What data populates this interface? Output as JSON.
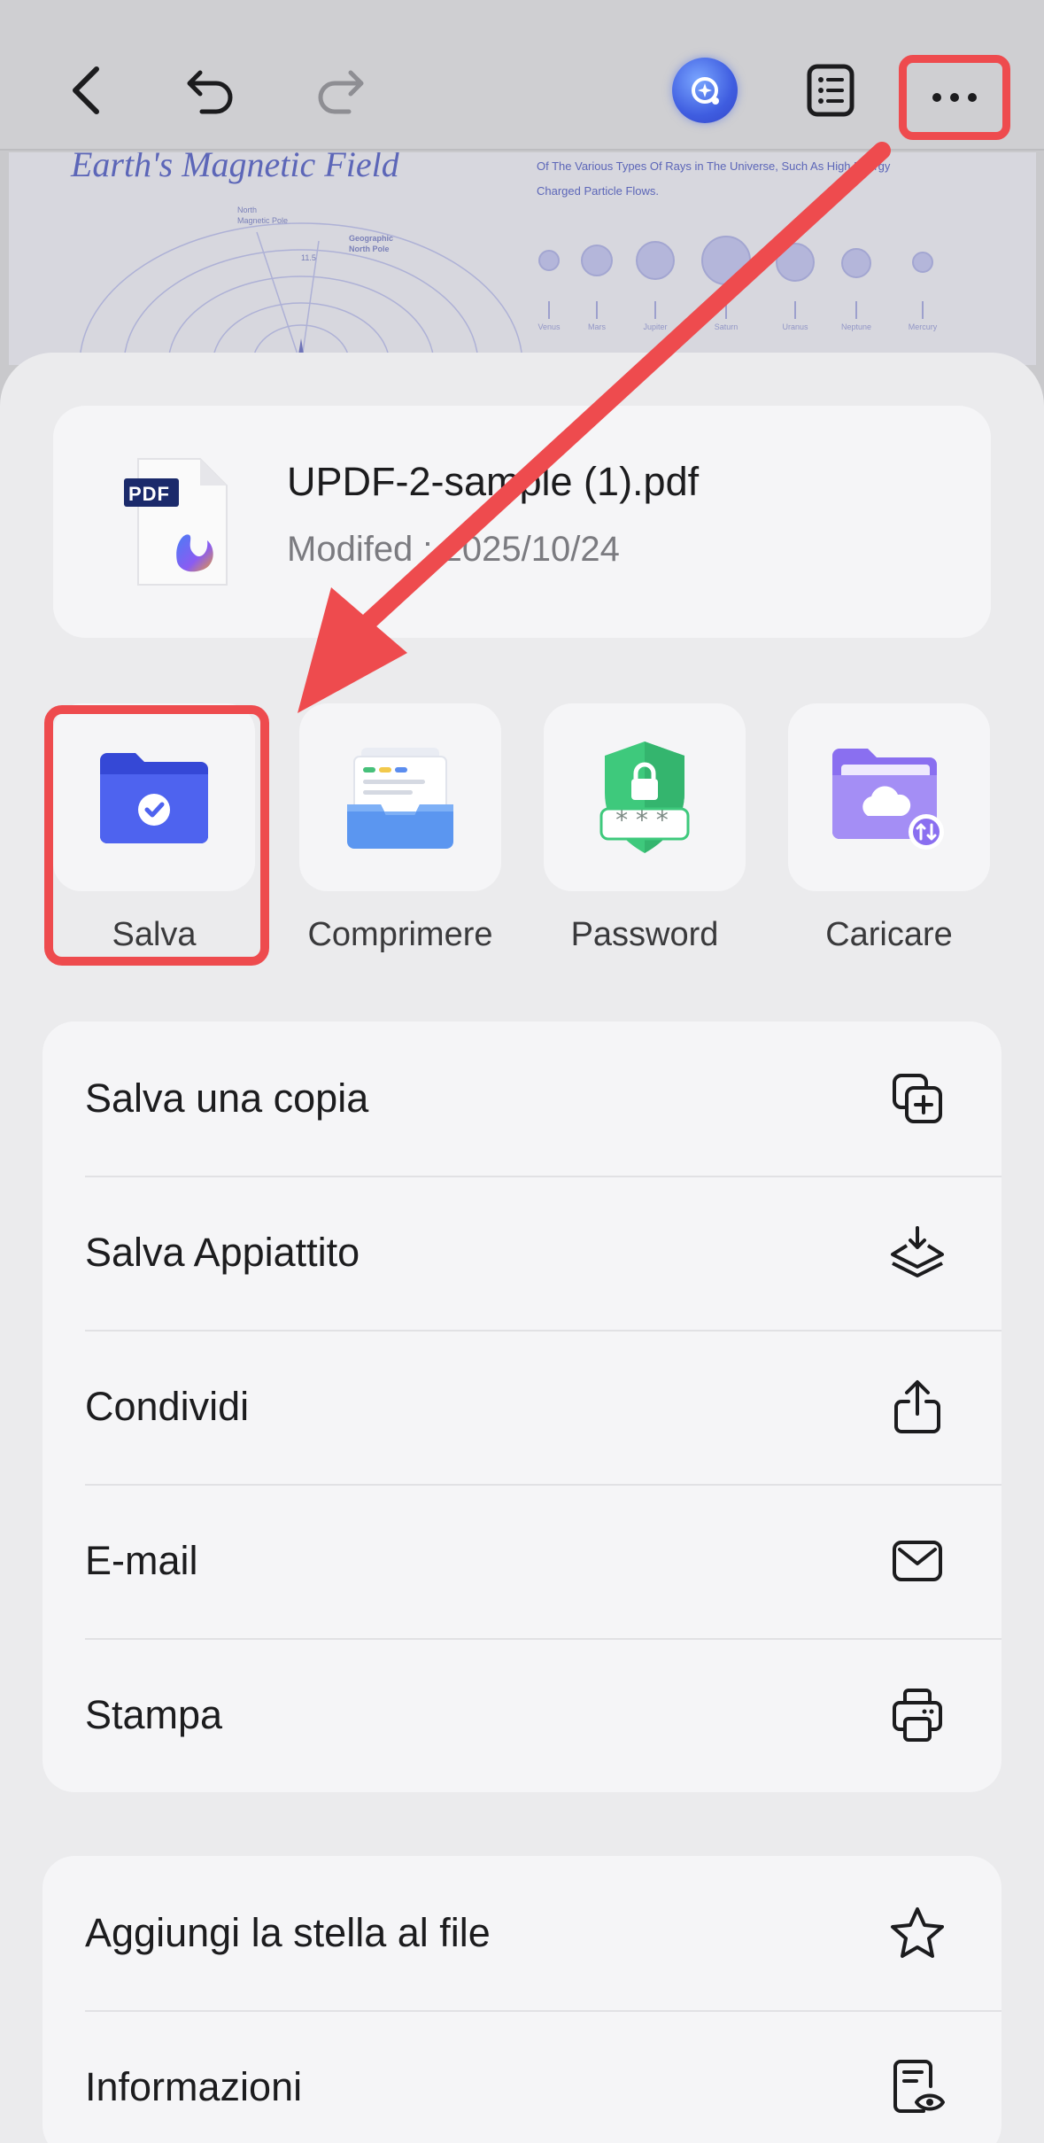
{
  "toolbar": {
    "back_icon": "chevron-left-icon",
    "undo_icon": "undo-icon",
    "redo_icon": "redo-icon",
    "ai_icon": "ai-assistant-icon",
    "outline_icon": "list-icon",
    "more_icon": "more-icon"
  },
  "background_pdf": {
    "title": "Earth's Magnetic Field",
    "text_line_1": "Of The Various Types Of Rays in The Universe, Such As High Energy",
    "text_line_2": "Charged Particle Flows.",
    "label_north_magnetic": "North",
    "label_north_magnetic_2": "Magnetic Pole",
    "label_geographic": "Geographic",
    "label_geographic_2": "North Pole",
    "label_angle": "11.5",
    "planets": [
      "Venus",
      "Mars",
      "Jupiter",
      "Saturn",
      "Uranus",
      "Neptune",
      "Mercury"
    ]
  },
  "file": {
    "name": "UPDF-2-sample (1).pdf",
    "modified": "Modifed : 2025/10/24",
    "badge": "PDF"
  },
  "tools": [
    {
      "label": "Salva",
      "icon": "folder-check-icon"
    },
    {
      "label": "Comprimere",
      "icon": "compress-tray-icon"
    },
    {
      "label": "Password",
      "icon": "shield-lock-icon"
    },
    {
      "label": "Caricare",
      "icon": "cloud-folder-icon"
    }
  ],
  "pwd_mask": "***",
  "menu_primary": [
    {
      "label": "Salva una copia",
      "icon": "copy-plus-icon"
    },
    {
      "label": "Salva Appiattito",
      "icon": "layers-download-icon"
    },
    {
      "label": "Condividi",
      "icon": "share-icon"
    },
    {
      "label": "E-mail",
      "icon": "mail-icon"
    },
    {
      "label": "Stampa",
      "icon": "printer-icon"
    }
  ],
  "menu_secondary": [
    {
      "label": "Aggiungi la stella al file",
      "icon": "star-icon"
    },
    {
      "label": "Informazioni",
      "icon": "document-eye-icon"
    }
  ],
  "colors": {
    "highlight": "#ee4b4e",
    "accent_blue": "#4b5fe6",
    "accent_green": "#3ec97c",
    "accent_purple": "#8b6cf0"
  }
}
